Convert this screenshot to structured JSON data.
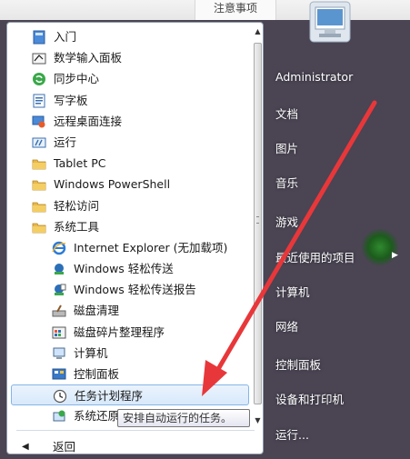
{
  "background": {
    "tab_label": "注意事项"
  },
  "programs": [
    {
      "label": "入门",
      "icon": "getting-started-icon",
      "level": 0
    },
    {
      "label": "数学输入面板",
      "icon": "math-input-icon",
      "level": 0
    },
    {
      "label": "同步中心",
      "icon": "sync-center-icon",
      "level": 0
    },
    {
      "label": "写字板",
      "icon": "wordpad-icon",
      "level": 0
    },
    {
      "label": "远程桌面连接",
      "icon": "remote-desktop-icon",
      "level": 0
    },
    {
      "label": "运行",
      "icon": "run-icon",
      "level": 0
    },
    {
      "label": "Tablet PC",
      "icon": "folder-icon",
      "level": 0
    },
    {
      "label": "Windows PowerShell",
      "icon": "folder-icon",
      "level": 0
    },
    {
      "label": "轻松访问",
      "icon": "folder-icon",
      "level": 0
    },
    {
      "label": "系统工具",
      "icon": "folder-icon",
      "level": 0
    },
    {
      "label": "Internet Explorer (无加载项)",
      "icon": "internet-explorer-icon",
      "level": 1
    },
    {
      "label": "Windows 轻松传送",
      "icon": "easy-transfer-icon",
      "level": 1
    },
    {
      "label": "Windows 轻松传送报告",
      "icon": "easy-transfer-report-icon",
      "level": 1
    },
    {
      "label": "磁盘清理",
      "icon": "disk-cleanup-icon",
      "level": 1
    },
    {
      "label": "磁盘碎片整理程序",
      "icon": "defragmenter-icon",
      "level": 1
    },
    {
      "label": "计算机",
      "icon": "computer-icon",
      "level": 1
    },
    {
      "label": "控制面板",
      "icon": "control-panel-icon",
      "level": 1
    },
    {
      "label": "任务计划程序",
      "icon": "clock-icon",
      "level": 1,
      "selected": true
    },
    {
      "label": "系统还原",
      "icon": "system-restore-icon",
      "level": 1
    }
  ],
  "back_label": "返回",
  "tooltip": "安排自动运行的任务。",
  "right_menu": [
    "Administrator",
    "文档",
    "图片",
    "音乐",
    "游戏",
    "最近使用的项目",
    "计算机",
    "网络",
    "控制面板",
    "设备和打印机",
    "运行..."
  ],
  "colors": {
    "menu_bg": "#4a4453",
    "selection_border": "#86b4e6",
    "annotation_arrow": "#e8373a"
  }
}
